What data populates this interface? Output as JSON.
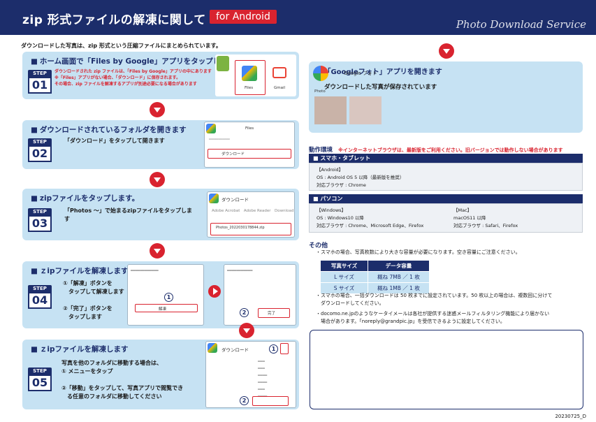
{
  "header": {
    "title": "zip 形式ファイルの解凍に関して",
    "badge": "for Android",
    "service": "Photo Download Service"
  },
  "intro": "ダウンロードした写真は、zip 形式という圧縮ファイルにまとめられています。",
  "steps": [
    {
      "num": "01",
      "tag": "STEP",
      "title": "ホーム画面で「Files by Google」アプリをタップします",
      "note": [
        "ダウンロードされた zip ファイルは、「Files by Google」アプリの中にあります",
        "※「Files」アプリがない場合、「ダウンロード」に保存されます。",
        "その場合、zip ファイルを解凍するアプリが別途必要になる場合があります"
      ],
      "shot_labels": [
        "Files",
        "Gmail"
      ]
    },
    {
      "num": "02",
      "tag": "STEP",
      "title": "ダウンロードされているフォルダを開きます",
      "body": [
        "「ダウンロード」をタップして開きます"
      ],
      "shot_labels": [
        "Files",
        "ダウンロード"
      ]
    },
    {
      "num": "03",
      "tag": "STEP",
      "title": "zipファイルをタップします。",
      "body": [
        "「Photos ～」で始まるzipファイルをタップしま",
        "す"
      ],
      "shot_labels": [
        "ダウンロード",
        "Photos_2022030178844.zip"
      ]
    },
    {
      "num": "04",
      "tag": "STEP",
      "title": "ｚipファイルを解凍します",
      "body": [
        "①「解凍」ボタンを",
        "　タップして解凍します",
        "",
        "②「完了」ボタンを",
        "　タップします"
      ],
      "shot_labels": [
        "解凍",
        "完了"
      ]
    },
    {
      "num": "05",
      "tag": "STEP",
      "title": "ｚipファイルを解凍します",
      "body": [
        "写真を他のフォルダに移動する場合は、",
        "① メニューをタップ",
        "",
        "②「移動」をタップして、写真アプリで閲覧でき",
        "　る任意のフォルダに移動してください"
      ],
      "shot_labels": [
        "ダウンロード"
      ]
    }
  ],
  "panel": {
    "title": "■「Googleフォト」アプリを開きます",
    "body": "ダウンロードした写真が保存されています",
    "shot_label": "Google フォト",
    "photo_label": "Photo"
  },
  "env": {
    "title": "動作環境",
    "warning": "※インターネットブラウザは、最新版をご利用ください。旧バージョンでは動作しない場合があります",
    "smartphone": {
      "bar": "■ スマホ・タブレット",
      "android_head": "【Android】",
      "android_os": "OS : Android OS 5 以降（最新版を推奨）",
      "android_browser": "対応ブラウザ : Chrome"
    },
    "pc": {
      "bar": "■ パソコン",
      "win_head": "【Windows】",
      "win_os": "OS : Windows10 以降",
      "win_browser": "対応ブラウザ : Chrome、Microsoft Edge、Firefox",
      "mac_head": "【Mac】",
      "mac_os": "macOS11 以降",
      "mac_browser": "対応ブラウザ : Safari、Firefox"
    }
  },
  "other": {
    "title": "その他",
    "bullet1": "・スマホの場合、写真枚数により大きな容量が必要になります。空き容量にご注意ください。",
    "table": {
      "headers": [
        "写真サイズ",
        "データ容量"
      ],
      "rows": [
        [
          "L サイズ",
          "概ね 7MB ／ 1 枚"
        ],
        [
          "S サイズ",
          "概ね 1MB ／ 1 枚"
        ]
      ]
    },
    "bullet2a": "・スマホの場合、一括ダウンロードは 50 枚までに設定されています。50 枚以上の場合は、複数回に分けて",
    "bullet2b": "　ダウンロードしてください。",
    "bullet3a": "・docomo.ne.jpのようなケータイメールは各社が提供する迷惑メールフィルタリング機能により届かない",
    "bullet3b": "　場合があります。「noreply@grandpic.jp」を受信できるように設定してください。"
  },
  "footer_code": "20230725_D",
  "colors": {
    "navy": "#1c2d6b",
    "red": "#d9232f",
    "lightblue": "#c6e2f3"
  }
}
